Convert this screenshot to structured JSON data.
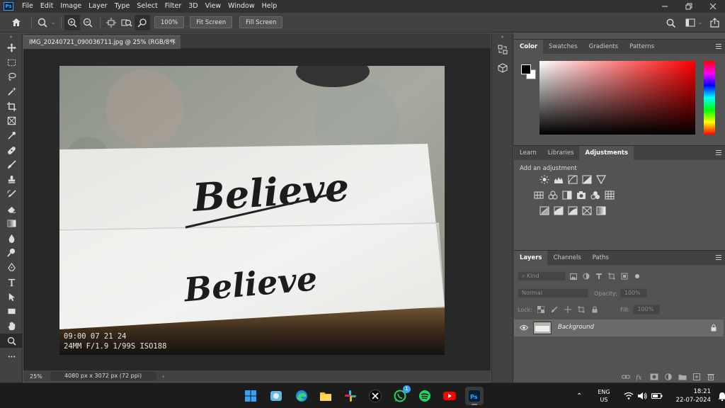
{
  "menubar": {
    "logo": "Ps",
    "items": [
      "File",
      "Edit",
      "Image",
      "Layer",
      "Type",
      "Select",
      "Filter",
      "3D",
      "View",
      "Window",
      "Help"
    ]
  },
  "options": {
    "zoom_percent": "100%",
    "fit_screen": "Fit Screen",
    "fill_screen": "Fill Screen"
  },
  "document": {
    "tab_title": "IMG_20240721_090036711.jpg @ 25% (RGB/8*)",
    "zoom": "25%",
    "dimensions": "4080 px x 3072 px (72 ppi)",
    "photo": {
      "text_top": "Believe",
      "text_bottom": "Believe",
      "stamp_time": "09:00 07 21 24",
      "stamp_info": "24MM F/1.9 1/99S ISO188"
    }
  },
  "color_panel": {
    "tabs": [
      "Color",
      "Swatches",
      "Gradients",
      "Patterns"
    ],
    "active_tab": "Color",
    "hue_color": "#ff0000"
  },
  "adjustments_panel": {
    "tabs": [
      "Learn",
      "Libraries",
      "Adjustments"
    ],
    "active_tab": "Adjustments",
    "label": "Add an adjustment"
  },
  "layers_panel": {
    "tabs": [
      "Layers",
      "Channels",
      "Paths"
    ],
    "active_tab": "Layers",
    "filter_kind": "Kind",
    "blend_mode": "Normal",
    "opacity_label": "Opacity:",
    "opacity_value": "100%",
    "lock_label": "Lock:",
    "fill_label": "Fill:",
    "fill_value": "100%",
    "layer_name": "Background"
  },
  "taskbar": {
    "language": "ENG",
    "region": "US",
    "time": "18:21",
    "date": "22-07-2024",
    "whatsapp_badge": "1"
  }
}
